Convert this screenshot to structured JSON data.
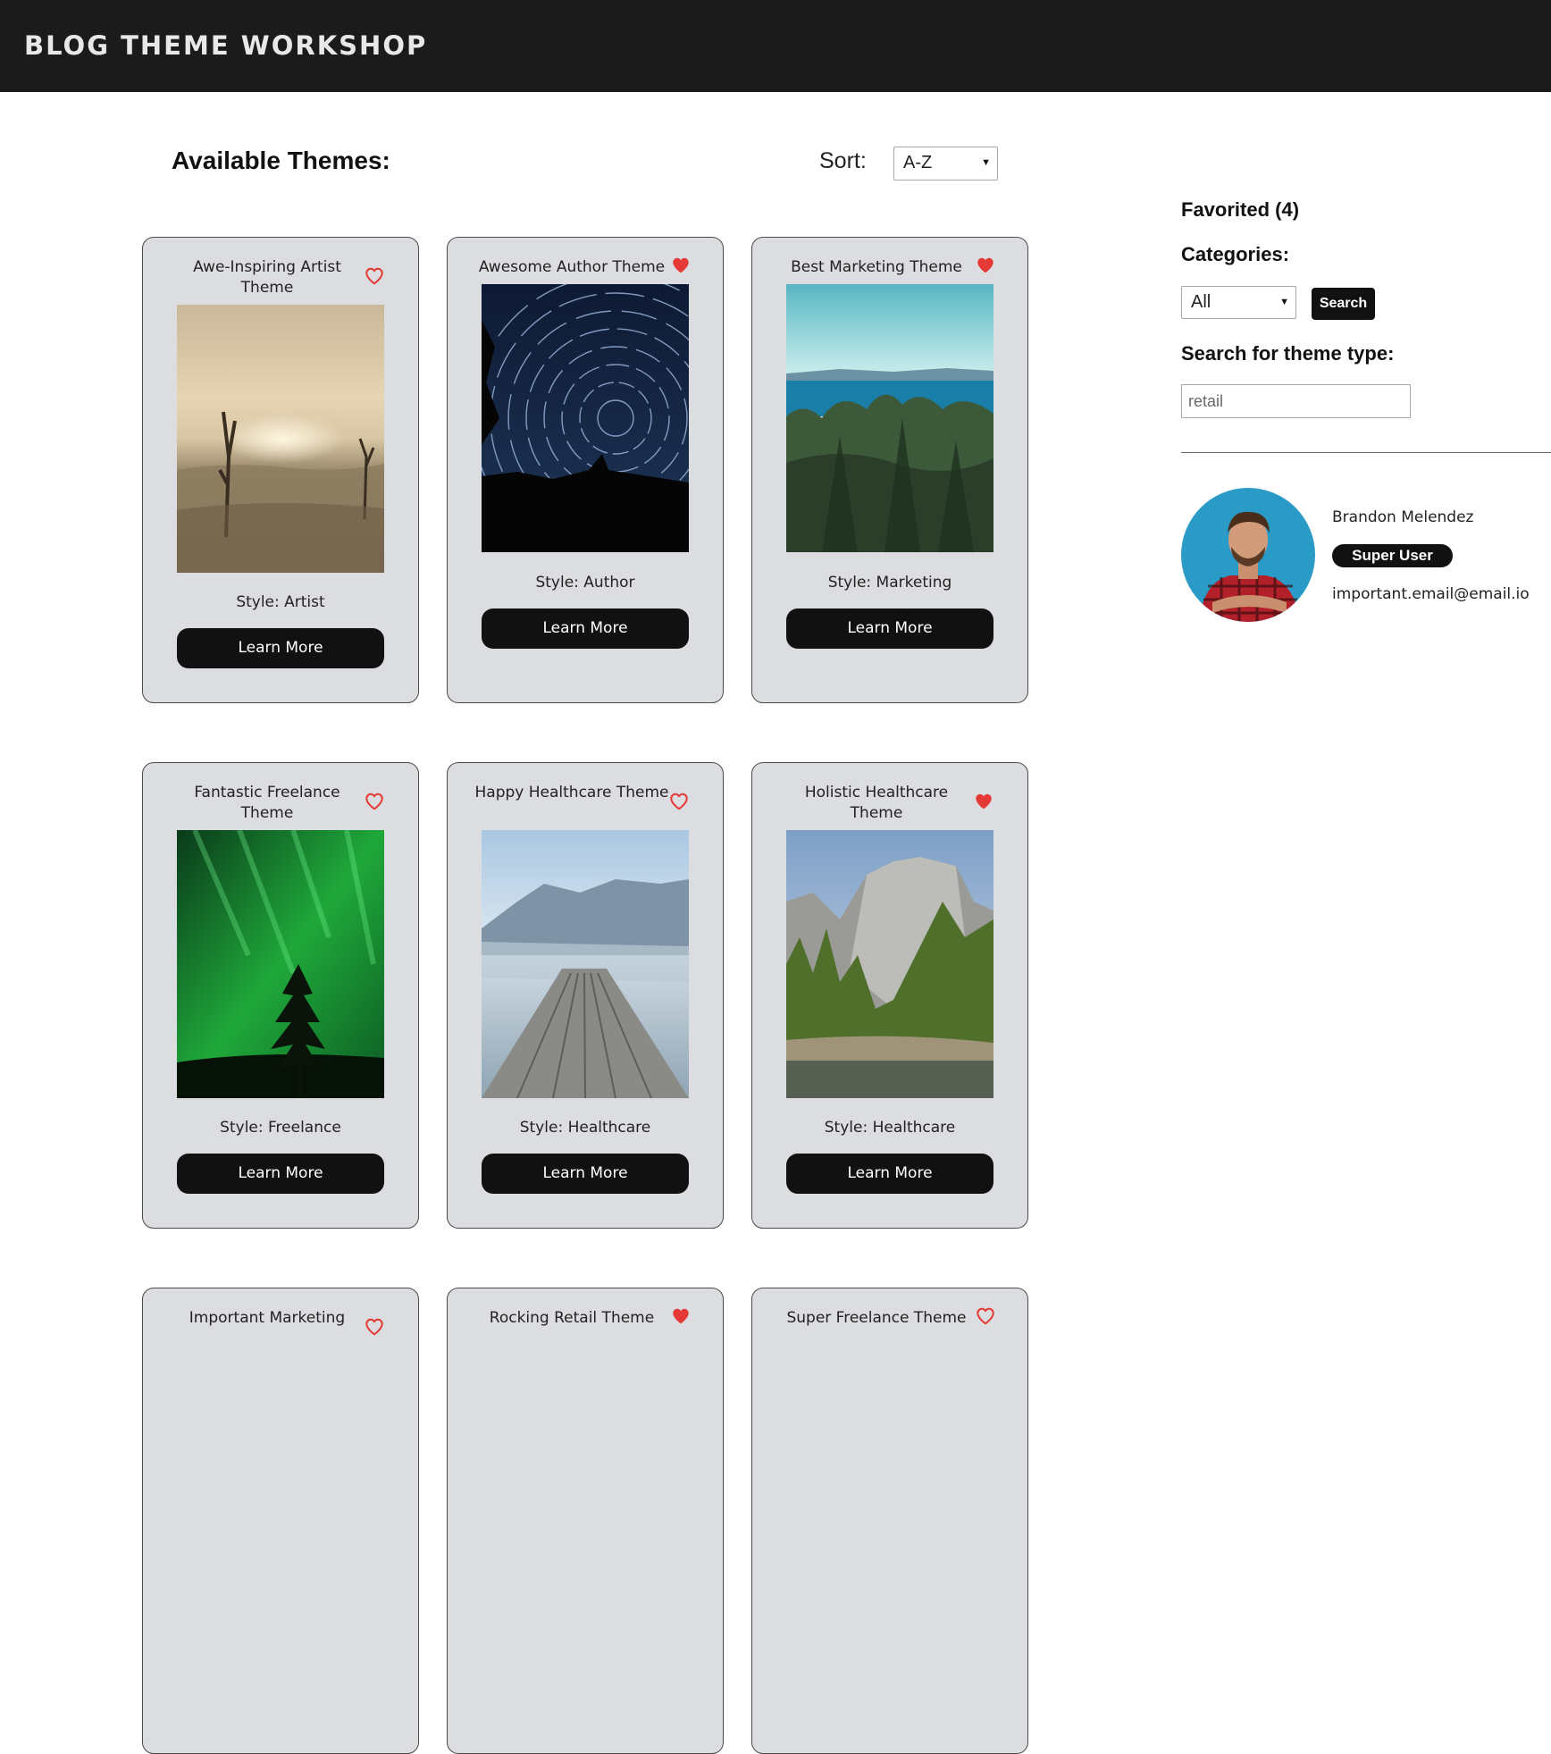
{
  "header": {
    "brand": "BLOG THEME WORKSHOP"
  },
  "main": {
    "heading": "Available Themes:",
    "sort_label": "Sort:",
    "sort_value": "A-Z"
  },
  "themes": [
    {
      "title": "Awe-Inspiring Artist Theme",
      "style": "Style: Artist",
      "button": "Learn More",
      "favorited": false
    },
    {
      "title": "Awesome Author Theme",
      "style": "Style: Author",
      "button": "Learn More",
      "favorited": true
    },
    {
      "title": "Best Marketing Theme",
      "style": "Style: Marketing",
      "button": "Learn More",
      "favorited": true
    },
    {
      "title": "Fantastic Freelance Theme",
      "style": "Style: Freelance",
      "button": "Learn More",
      "favorited": false
    },
    {
      "title": "Happy Healthcare Theme",
      "style": "Style: Healthcare",
      "button": "Learn More",
      "favorited": false
    },
    {
      "title": "Holistic Healthcare Theme",
      "style": "Style: Healthcare",
      "button": "Learn More",
      "favorited": true
    },
    {
      "title": "Important Marketing",
      "favorited": false
    },
    {
      "title": "Rocking Retail Theme",
      "favorited": true
    },
    {
      "title": "Super Freelance Theme",
      "favorited": false
    }
  ],
  "sidebar": {
    "favorited": "Favorited (4)",
    "categories_label": "Categories:",
    "category_value": "All",
    "search_button": "Search",
    "search_label": "Search for theme type:",
    "search_placeholder": "retail"
  },
  "user": {
    "name": "Brandon Melendez",
    "role": "Super User",
    "email": "important.email@email.io"
  },
  "colors": {
    "heart": "#e53935",
    "header_bg": "#1b1b1b",
    "card_bg": "#dcdde0"
  }
}
